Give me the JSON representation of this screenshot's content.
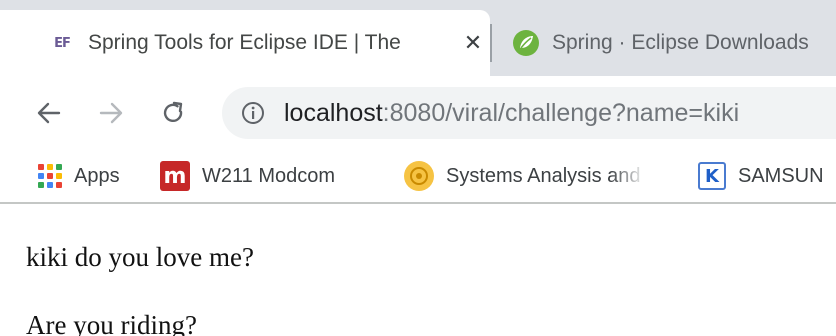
{
  "browser": {
    "tabs": [
      {
        "title": "Spring Tools for Eclipse IDE | The",
        "favicon": "ef-icon",
        "active": true,
        "close_glyph": "✕"
      },
      {
        "title": "Spring · Eclipse Downloads",
        "favicon": "spring-leaf-icon",
        "active": false
      }
    ],
    "toolbar": {
      "back_icon": "arrow-left-icon",
      "forward_icon": "arrow-right-icon",
      "reload_icon": "reload-icon",
      "url_host": "localhost",
      "url_rest": ":8080/viral/challenge?name=kiki"
    },
    "bookmarks": [
      {
        "label": "Apps",
        "icon": "apps-grid-icon"
      },
      {
        "label": "W211 Modcom",
        "icon": "m-logo-icon"
      },
      {
        "label": "Systems Analysis and",
        "icon": "systems-icon"
      },
      {
        "label": "SAMSUN",
        "icon": "k-logo-icon"
      }
    ]
  },
  "page": {
    "line_1": "kiki do you love me?",
    "line_2": "Are you riding?"
  },
  "colors": {
    "tabstrip_bg": "#dee1e6",
    "omnibox_bg": "#f1f3f4",
    "spring_green": "#6db33f",
    "m_logo_red": "#c62828",
    "k_logo_blue": "#1f5fc8"
  }
}
